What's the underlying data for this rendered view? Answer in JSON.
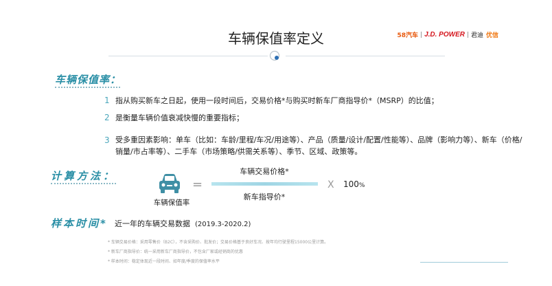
{
  "header": {
    "title": "车辆保值率定义",
    "logos": {
      "logo_58": "58汽车",
      "logo_jd": "J.D. POWER",
      "logo_jun": "君迪",
      "logo_yx": "优信"
    }
  },
  "sections": {
    "definition_heading": "车辆保值率：",
    "formula_heading": "计算方法：",
    "sample_heading": "样本时间*"
  },
  "definition_items": [
    {
      "num": "1",
      "text": "指从购买新车之日起，使用一段时间后，交易价格*与购买时新车厂商指导价*（MSRP）的比值；"
    },
    {
      "num": "2",
      "text": "是衡量车辆价值衰减快慢的重要指标；"
    },
    {
      "num": "3",
      "text": "受多重因素影响：单车（比如：车龄/里程/车况/用途等）、产品（质量/设计/配置/性能等）、品牌（影响力等）、新车（价格/销量/市占率等）、二手车（市场策略/供需关系等）、季节、区域、政策等。"
    }
  ],
  "formula": {
    "car_label": "车辆保值率",
    "equals": "=",
    "numerator": "车辆交易价格*",
    "denominator": "新车指导价*",
    "times": "X",
    "hundred": "100",
    "percent": "%"
  },
  "sample": {
    "text": "近一年的车辆交易数据",
    "period": "(2019.3-2020.2)"
  },
  "notes": [
    "* 车辆交易价格：采用零售价（B2C），不含采购价、批发价；交易价格基于良好车况、按年均行驶里程15000公里计算。",
    "* 新车厂商指导价：统一采用新车厂商指导价，不包含厂家或经销商的优惠",
    "* 样本时间：稳定体现近一段时间、如年度/季度的保值率水平"
  ],
  "colors": {
    "accent": "#2a8fa6",
    "car_icon": "#3f8fa5",
    "formula_bar": "#b7e4ee"
  },
  "icons": {
    "section_divider": "circle-dot-icon",
    "formula": "car-icon"
  }
}
